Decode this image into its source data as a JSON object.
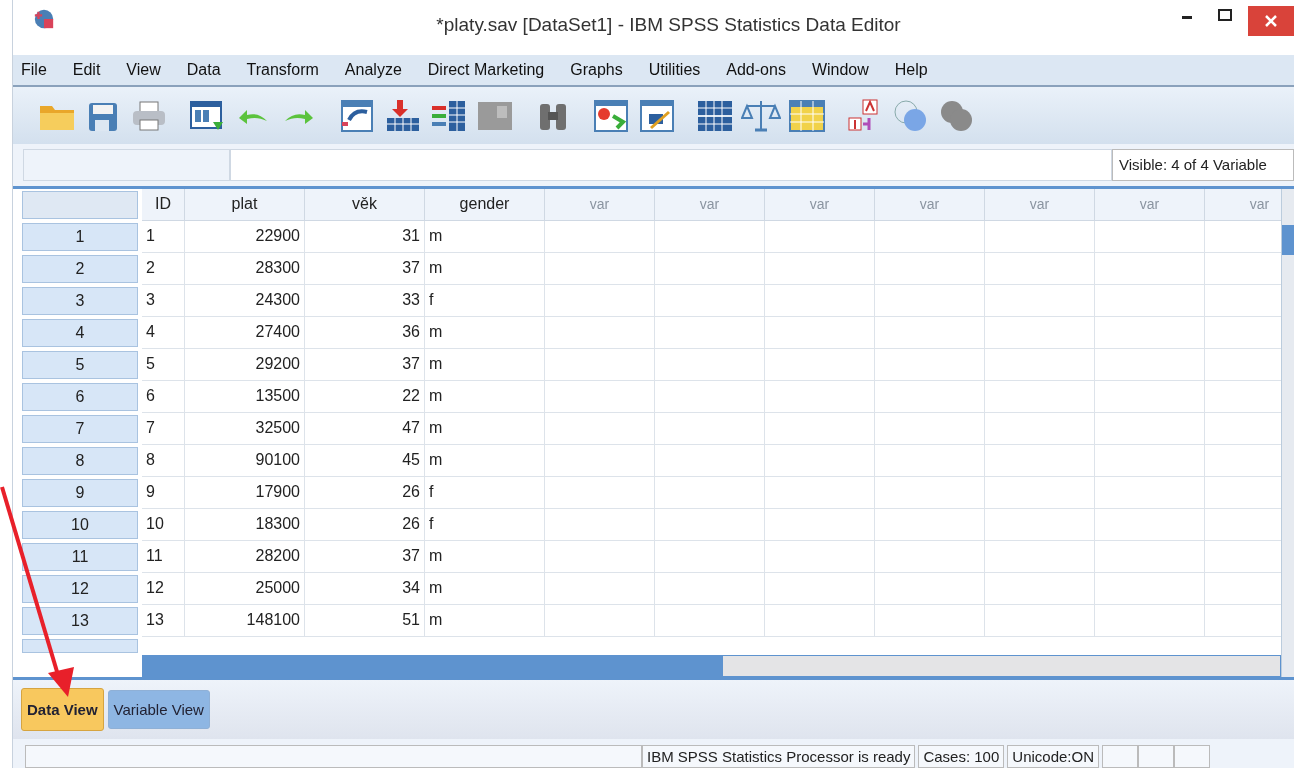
{
  "window": {
    "title": "*platy.sav [DataSet1] - IBM SPSS Statistics Data Editor"
  },
  "menu": [
    "File",
    "Edit",
    "View",
    "Data",
    "Transform",
    "Analyze",
    "Direct Marketing",
    "Graphs",
    "Utilities",
    "Add-ons",
    "Window",
    "Help"
  ],
  "visible_info": "Visible: 4 of 4 Variable",
  "table": {
    "columns": [
      {
        "label": "ID",
        "kind": "string"
      },
      {
        "label": "plat",
        "kind": "numeric"
      },
      {
        "label": "věk",
        "kind": "numeric"
      },
      {
        "label": "gender",
        "kind": "string"
      },
      {
        "label": "var",
        "kind": "empty"
      },
      {
        "label": "var",
        "kind": "empty"
      },
      {
        "label": "var",
        "kind": "empty"
      },
      {
        "label": "var",
        "kind": "empty"
      },
      {
        "label": "var",
        "kind": "empty"
      },
      {
        "label": "var",
        "kind": "empty"
      },
      {
        "label": "var",
        "kind": "empty"
      }
    ],
    "rows": [
      {
        "number": "1",
        "cells": [
          "1",
          "22900",
          "31",
          "m"
        ]
      },
      {
        "number": "2",
        "cells": [
          "2",
          "28300",
          "37",
          "m"
        ]
      },
      {
        "number": "3",
        "cells": [
          "3",
          "24300",
          "33",
          "f"
        ]
      },
      {
        "number": "4",
        "cells": [
          "4",
          "27400",
          "36",
          "m"
        ]
      },
      {
        "number": "5",
        "cells": [
          "5",
          "29200",
          "37",
          "m"
        ]
      },
      {
        "number": "6",
        "cells": [
          "6",
          "13500",
          "22",
          "m"
        ]
      },
      {
        "number": "7",
        "cells": [
          "7",
          "32500",
          "47",
          "m"
        ]
      },
      {
        "number": "8",
        "cells": [
          "8",
          "90100",
          "45",
          "m"
        ]
      },
      {
        "number": "9",
        "cells": [
          "9",
          "17900",
          "26",
          "f"
        ]
      },
      {
        "number": "10",
        "cells": [
          "10",
          "18300",
          "26",
          "f"
        ]
      },
      {
        "number": "11",
        "cells": [
          "11",
          "28200",
          "37",
          "m"
        ]
      },
      {
        "number": "12",
        "cells": [
          "12",
          "25000",
          "34",
          "m"
        ]
      },
      {
        "number": "13",
        "cells": [
          "13",
          "148100",
          "51",
          "m"
        ]
      }
    ]
  },
  "tabs": [
    {
      "label": "Data View",
      "selected": true
    },
    {
      "label": "Variable View",
      "selected": false
    }
  ],
  "status_bar": [
    "IBM SPSS Statistics Processor is ready",
    "Cases: 100",
    "Unicode:ON"
  ]
}
